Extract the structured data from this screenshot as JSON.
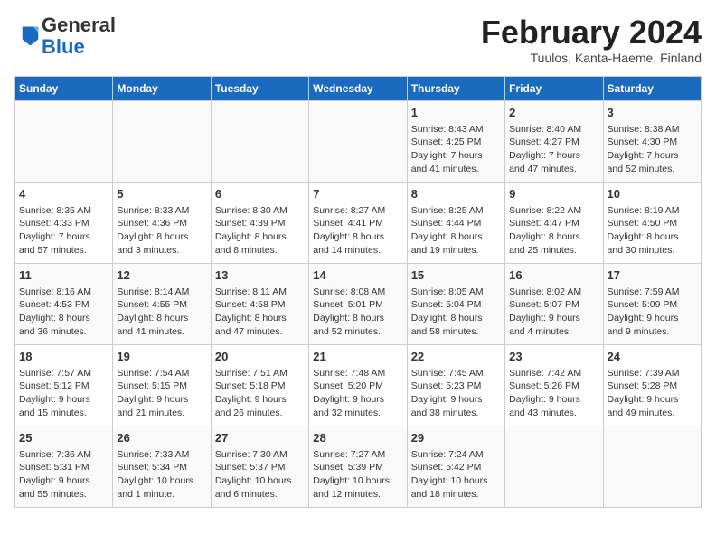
{
  "header": {
    "logo_line1": "General",
    "logo_line2": "Blue",
    "month_title": "February 2024",
    "location": "Tuulos, Kanta-Haeme, Finland"
  },
  "days_of_week": [
    "Sunday",
    "Monday",
    "Tuesday",
    "Wednesday",
    "Thursday",
    "Friday",
    "Saturday"
  ],
  "weeks": [
    [
      {
        "num": "",
        "detail": ""
      },
      {
        "num": "",
        "detail": ""
      },
      {
        "num": "",
        "detail": ""
      },
      {
        "num": "",
        "detail": ""
      },
      {
        "num": "1",
        "detail": "Sunrise: 8:43 AM\nSunset: 4:25 PM\nDaylight: 7 hours\nand 41 minutes."
      },
      {
        "num": "2",
        "detail": "Sunrise: 8:40 AM\nSunset: 4:27 PM\nDaylight: 7 hours\nand 47 minutes."
      },
      {
        "num": "3",
        "detail": "Sunrise: 8:38 AM\nSunset: 4:30 PM\nDaylight: 7 hours\nand 52 minutes."
      }
    ],
    [
      {
        "num": "4",
        "detail": "Sunrise: 8:35 AM\nSunset: 4:33 PM\nDaylight: 7 hours\nand 57 minutes."
      },
      {
        "num": "5",
        "detail": "Sunrise: 8:33 AM\nSunset: 4:36 PM\nDaylight: 8 hours\nand 3 minutes."
      },
      {
        "num": "6",
        "detail": "Sunrise: 8:30 AM\nSunset: 4:39 PM\nDaylight: 8 hours\nand 8 minutes."
      },
      {
        "num": "7",
        "detail": "Sunrise: 8:27 AM\nSunset: 4:41 PM\nDaylight: 8 hours\nand 14 minutes."
      },
      {
        "num": "8",
        "detail": "Sunrise: 8:25 AM\nSunset: 4:44 PM\nDaylight: 8 hours\nand 19 minutes."
      },
      {
        "num": "9",
        "detail": "Sunrise: 8:22 AM\nSunset: 4:47 PM\nDaylight: 8 hours\nand 25 minutes."
      },
      {
        "num": "10",
        "detail": "Sunrise: 8:19 AM\nSunset: 4:50 PM\nDaylight: 8 hours\nand 30 minutes."
      }
    ],
    [
      {
        "num": "11",
        "detail": "Sunrise: 8:16 AM\nSunset: 4:53 PM\nDaylight: 8 hours\nand 36 minutes."
      },
      {
        "num": "12",
        "detail": "Sunrise: 8:14 AM\nSunset: 4:55 PM\nDaylight: 8 hours\nand 41 minutes."
      },
      {
        "num": "13",
        "detail": "Sunrise: 8:11 AM\nSunset: 4:58 PM\nDaylight: 8 hours\nand 47 minutes."
      },
      {
        "num": "14",
        "detail": "Sunrise: 8:08 AM\nSunset: 5:01 PM\nDaylight: 8 hours\nand 52 minutes."
      },
      {
        "num": "15",
        "detail": "Sunrise: 8:05 AM\nSunset: 5:04 PM\nDaylight: 8 hours\nand 58 minutes."
      },
      {
        "num": "16",
        "detail": "Sunrise: 8:02 AM\nSunset: 5:07 PM\nDaylight: 9 hours\nand 4 minutes."
      },
      {
        "num": "17",
        "detail": "Sunrise: 7:59 AM\nSunset: 5:09 PM\nDaylight: 9 hours\nand 9 minutes."
      }
    ],
    [
      {
        "num": "18",
        "detail": "Sunrise: 7:57 AM\nSunset: 5:12 PM\nDaylight: 9 hours\nand 15 minutes."
      },
      {
        "num": "19",
        "detail": "Sunrise: 7:54 AM\nSunset: 5:15 PM\nDaylight: 9 hours\nand 21 minutes."
      },
      {
        "num": "20",
        "detail": "Sunrise: 7:51 AM\nSunset: 5:18 PM\nDaylight: 9 hours\nand 26 minutes."
      },
      {
        "num": "21",
        "detail": "Sunrise: 7:48 AM\nSunset: 5:20 PM\nDaylight: 9 hours\nand 32 minutes."
      },
      {
        "num": "22",
        "detail": "Sunrise: 7:45 AM\nSunset: 5:23 PM\nDaylight: 9 hours\nand 38 minutes."
      },
      {
        "num": "23",
        "detail": "Sunrise: 7:42 AM\nSunset: 5:26 PM\nDaylight: 9 hours\nand 43 minutes."
      },
      {
        "num": "24",
        "detail": "Sunrise: 7:39 AM\nSunset: 5:28 PM\nDaylight: 9 hours\nand 49 minutes."
      }
    ],
    [
      {
        "num": "25",
        "detail": "Sunrise: 7:36 AM\nSunset: 5:31 PM\nDaylight: 9 hours\nand 55 minutes."
      },
      {
        "num": "26",
        "detail": "Sunrise: 7:33 AM\nSunset: 5:34 PM\nDaylight: 10 hours\nand 1 minute."
      },
      {
        "num": "27",
        "detail": "Sunrise: 7:30 AM\nSunset: 5:37 PM\nDaylight: 10 hours\nand 6 minutes."
      },
      {
        "num": "28",
        "detail": "Sunrise: 7:27 AM\nSunset: 5:39 PM\nDaylight: 10 hours\nand 12 minutes."
      },
      {
        "num": "29",
        "detail": "Sunrise: 7:24 AM\nSunset: 5:42 PM\nDaylight: 10 hours\nand 18 minutes."
      },
      {
        "num": "",
        "detail": ""
      },
      {
        "num": "",
        "detail": ""
      }
    ]
  ]
}
